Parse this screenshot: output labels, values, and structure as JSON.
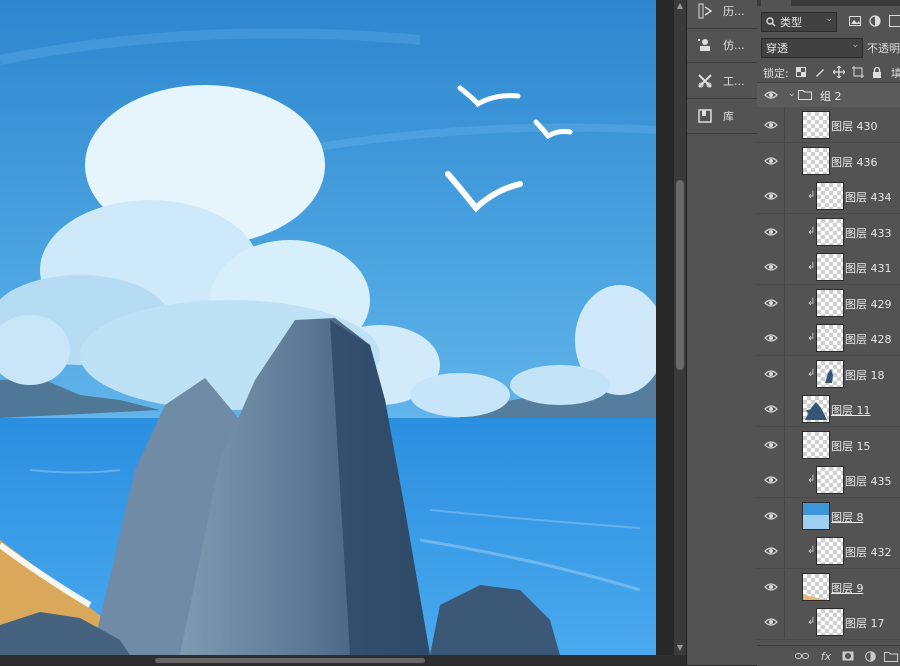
{
  "history_panel": {
    "items": [
      {
        "label": "历...",
        "icon": "history-icon"
      },
      {
        "label": "仿...",
        "icon": "clone-source-icon"
      },
      {
        "label": "工...",
        "icon": "tool-presets-icon"
      },
      {
        "label": "库",
        "icon": "libraries-icon"
      }
    ]
  },
  "layers_panel": {
    "filter_kind": "类型",
    "blend_mode": "穿透",
    "opacity_label": "不透明",
    "lock_label": "锁定:",
    "fill_label": "填",
    "group": {
      "name": "组 2"
    },
    "layers": [
      {
        "name": "图层 430",
        "clipped": false,
        "underlined": false,
        "thumb": "blank"
      },
      {
        "name": "图层 436",
        "clipped": false,
        "underlined": false,
        "thumb": "blank"
      },
      {
        "name": "图层 434",
        "clipped": true,
        "underlined": false,
        "thumb": "blank"
      },
      {
        "name": "图层 433",
        "clipped": true,
        "underlined": false,
        "thumb": "blank"
      },
      {
        "name": "图层 431",
        "clipped": true,
        "underlined": false,
        "thumb": "blank"
      },
      {
        "name": "图层 429",
        "clipped": true,
        "underlined": false,
        "thumb": "blank"
      },
      {
        "name": "图层 428",
        "clipped": true,
        "underlined": false,
        "thumb": "blank"
      },
      {
        "name": "图层 18",
        "clipped": true,
        "underlined": false,
        "thumb": "rock-small"
      },
      {
        "name": "图层 11",
        "clipped": false,
        "underlined": true,
        "thumb": "rock"
      },
      {
        "name": "图层 15",
        "clipped": false,
        "underlined": false,
        "thumb": "blank"
      },
      {
        "name": "图层 435",
        "clipped": true,
        "underlined": false,
        "thumb": "blank"
      },
      {
        "name": "图层 8",
        "clipped": false,
        "underlined": true,
        "thumb": "sky"
      },
      {
        "name": "图层 432",
        "clipped": true,
        "underlined": false,
        "thumb": "blank"
      },
      {
        "name": "图层 9",
        "clipped": false,
        "underlined": true,
        "thumb": "sand"
      },
      {
        "name": "图层 17",
        "clipped": true,
        "underlined": false,
        "thumb": "blank"
      }
    ]
  },
  "colors": {
    "sky": "#3f95d4",
    "sea": "#3a9be8",
    "rock": "#42607f",
    "panel_bg": "#535353"
  }
}
